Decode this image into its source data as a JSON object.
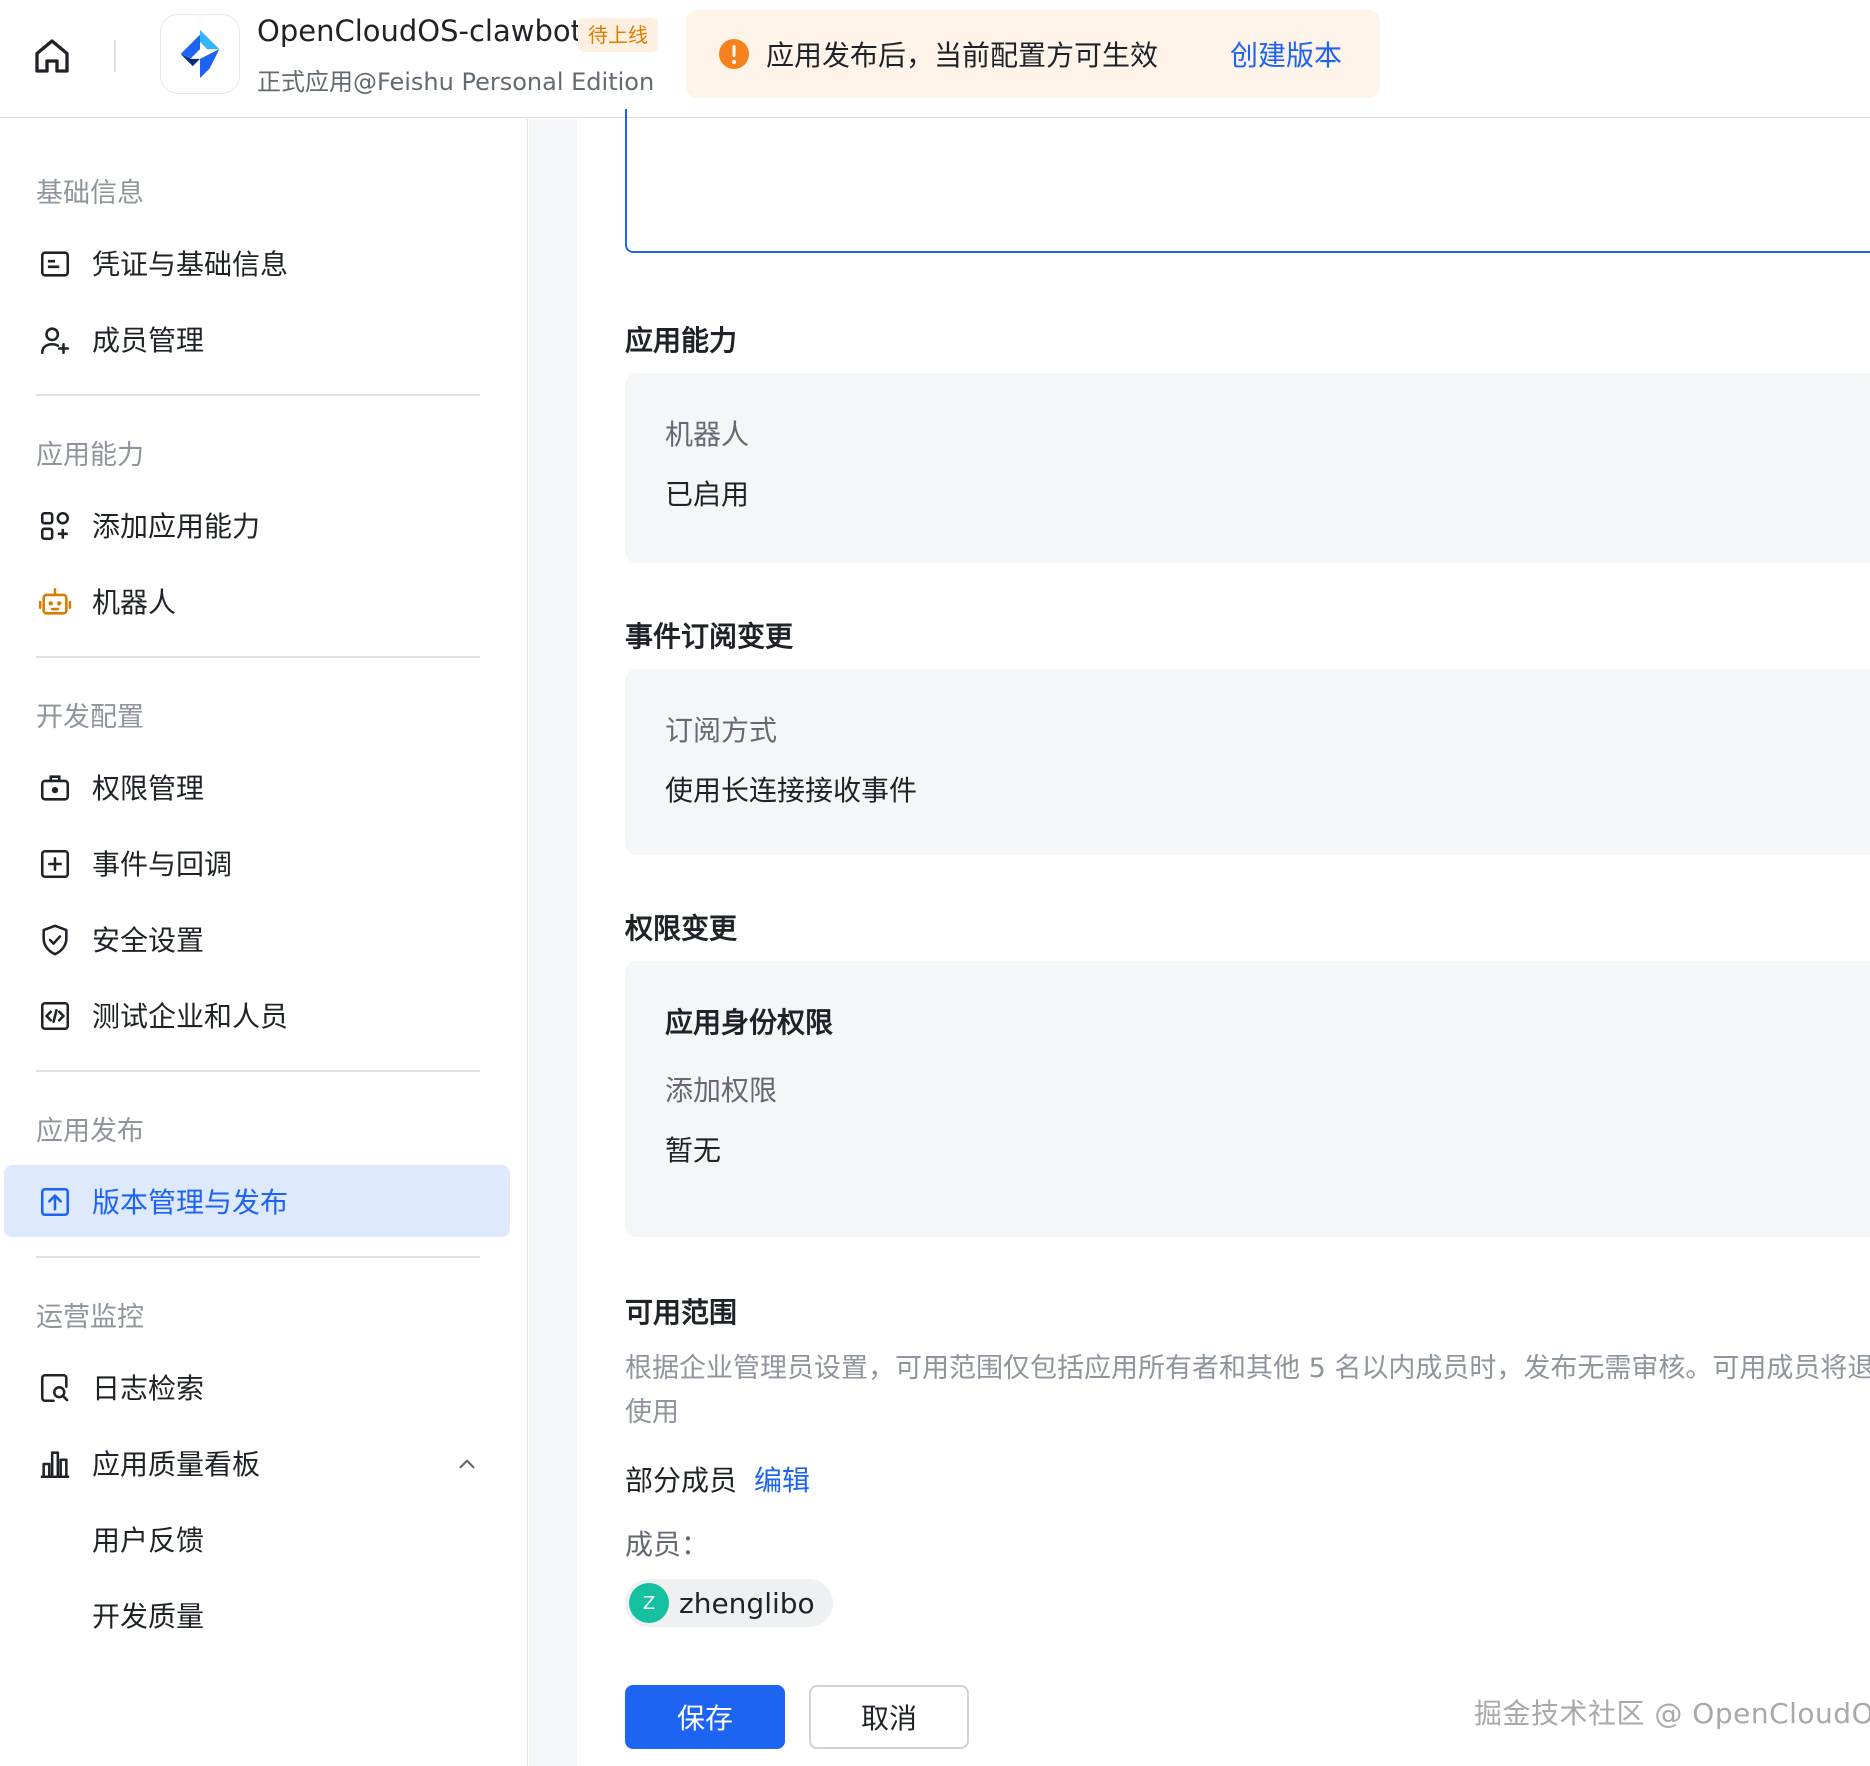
{
  "header": {
    "app_title": "OpenCloudOS-clawbot",
    "status_badge": "待上线",
    "app_subtitle": "正式应用@Feishu Personal Edition",
    "notice_text": "应用发布后，当前配置方可生效",
    "notice_link": "创建版本",
    "colors": {
      "accent": "#1d64f2",
      "warning": "#f5821f",
      "notice_bg": "#fef4e9"
    }
  },
  "sidebar": {
    "groups": [
      {
        "title": "基础信息",
        "items": [
          {
            "label": "凭证与基础信息",
            "icon": "credential-icon"
          },
          {
            "label": "成员管理",
            "icon": "add-member-icon"
          }
        ]
      },
      {
        "title": "应用能力",
        "items": [
          {
            "label": "添加应用能力",
            "icon": "apps-grid-icon"
          },
          {
            "label": "机器人",
            "icon": "robot-icon"
          }
        ]
      },
      {
        "title": "开发配置",
        "items": [
          {
            "label": "权限管理",
            "icon": "briefcase-lock-icon"
          },
          {
            "label": "事件与回调",
            "icon": "plus-square-icon"
          },
          {
            "label": "安全设置",
            "icon": "shield-icon"
          },
          {
            "label": "测试企业和人员",
            "icon": "code-box-icon"
          }
        ]
      },
      {
        "title": "应用发布",
        "items": [
          {
            "label": "版本管理与发布",
            "icon": "upload-box-icon",
            "active": true
          }
        ]
      },
      {
        "title": "运营监控",
        "items": [
          {
            "label": "日志检索",
            "icon": "log-search-icon"
          },
          {
            "label": "应用质量看板",
            "icon": "bar-chart-icon",
            "expanded": true
          },
          {
            "label": "用户反馈"
          },
          {
            "label": "开发质量"
          }
        ]
      }
    ]
  },
  "main": {
    "capability": {
      "title": "应用能力",
      "label": "机器人",
      "value": "已启用"
    },
    "events": {
      "title": "事件订阅变更",
      "label": "订阅方式",
      "value": "使用长连接接收事件"
    },
    "permissions": {
      "title": "权限变更",
      "head": "应用身份权限",
      "label": "添加权限",
      "value": "暂无"
    },
    "scope": {
      "title": "可用范围",
      "description": "根据企业管理员设置，可用范围仅包括应用所有者和其他 5 名以内成员时，发布无需审核。可用成员将退出使用",
      "type": "部分成员",
      "edit_link": "编辑",
      "members_label": "成员：",
      "members": [
        {
          "initial": "Z",
          "name": "zhenglibo"
        }
      ]
    },
    "actions": {
      "save": "保存",
      "cancel": "取消"
    }
  },
  "watermark": "掘金技术社区 @ OpenCloudOS"
}
